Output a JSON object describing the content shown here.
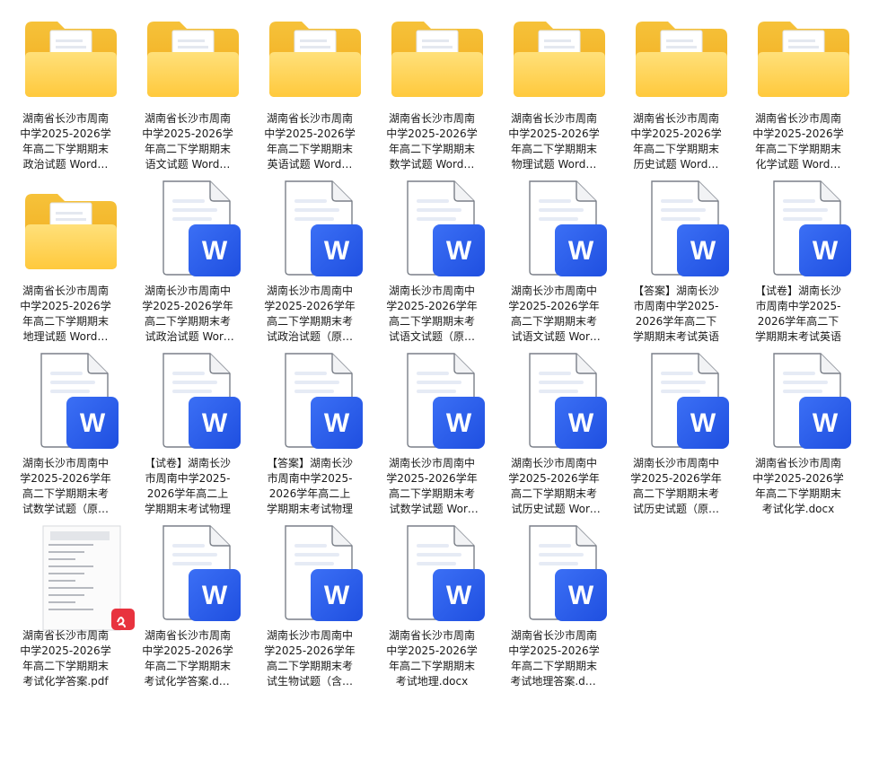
{
  "colors": {
    "folder_back": "#f4b92c",
    "folder_front": "#ffd45c",
    "word_blue": "#2f5ff0",
    "pdf_red": "#e8333f"
  },
  "items": [
    {
      "type": "folder",
      "icon": "folder-icon",
      "label": "湖南省长沙市周南中学2025-2026学年高二下学期期末政治试题 Word版含解析"
    },
    {
      "type": "folder",
      "icon": "folder-icon",
      "label": "湖南省长沙市周南中学2025-2026学年高二下学期期末语文试题 Word版含解析"
    },
    {
      "type": "folder",
      "icon": "folder-icon",
      "label": "湖南省长沙市周南中学2025-2026学年高二下学期期末英语试题 Word版含解析"
    },
    {
      "type": "folder",
      "icon": "folder-icon",
      "label": "湖南省长沙市周南中学2025-2026学年高二下学期期末数学试题 Word版含解析"
    },
    {
      "type": "folder",
      "icon": "folder-icon",
      "label": "湖南省长沙市周南中学2025-2026学年高二下学期期末物理试题 Word版含解析"
    },
    {
      "type": "folder",
      "icon": "folder-icon",
      "label": "湖南省长沙市周南中学2025-2026学年高二下学期期末历史试题 Word版含解析"
    },
    {
      "type": "folder",
      "icon": "folder-icon",
      "label": "湖南省长沙市周南中学2025-2026学年高二下学期期末化学试题 Word版含解析"
    },
    {
      "type": "folder",
      "icon": "folder-icon",
      "label": "湖南省长沙市周南中学2025-2026学年高二下学期期末地理试题 Word版含解析"
    },
    {
      "type": "word",
      "icon": "word-file-icon",
      "label": "湖南长沙市周南中学2025-2026学年高二下学期期末考试政治试题 Word版含解析"
    },
    {
      "type": "word",
      "icon": "word-file-icon",
      "label": "湖南长沙市周南中学2025-2026学年高二下学期期末考试政治试题（原卷版）"
    },
    {
      "type": "word",
      "icon": "word-file-icon",
      "label": "湖南长沙市周南中学2025-2026学年高二下学期期末考试语文试题（原卷版）"
    },
    {
      "type": "word",
      "icon": "word-file-icon",
      "label": "湖南长沙市周南中学2025-2026学年高二下学期期末考试语文试题 Word版含解析"
    },
    {
      "type": "word",
      "icon": "word-file-icon",
      "label": "【答案】湖南长沙市周南中学2025-2026学年高二下学期期末考试英语"
    },
    {
      "type": "word",
      "icon": "word-file-icon",
      "label": "【试卷】湖南长沙市周南中学2025-2026学年高二下学期期末考试英语"
    },
    {
      "type": "word",
      "icon": "word-file-icon",
      "label": "湖南长沙市周南中学2025-2026学年高二下学期期末考试数学试题（原卷版）"
    },
    {
      "type": "word",
      "icon": "word-file-icon",
      "label": "【试卷】湖南长沙市周南中学2025-2026学年高二上学期期末考试物理"
    },
    {
      "type": "word",
      "icon": "word-file-icon",
      "label": "【答案】湖南长沙市周南中学2025-2026学年高二上学期期末考试物理"
    },
    {
      "type": "word",
      "icon": "word-file-icon",
      "label": "湖南长沙市周南中学2025-2026学年高二下学期期末考试数学试题 Word版含解析"
    },
    {
      "type": "word",
      "icon": "word-file-icon",
      "label": "湖南长沙市周南中学2025-2026学年高二下学期期末考试历史试题 Word版含解析"
    },
    {
      "type": "word",
      "icon": "word-file-icon",
      "label": "湖南长沙市周南中学2025-2026学年高二下学期期末考试历史试题（原卷版）"
    },
    {
      "type": "word",
      "icon": "word-file-icon",
      "label": "湖南省长沙市周南中学2025-2026学年高二下学期期末考试化学.docx"
    },
    {
      "type": "pdf",
      "icon": "pdf-thumbnail-icon",
      "label": "湖南省长沙市周南中学2025-2026学年高二下学期期末考试化学答案.pdf"
    },
    {
      "type": "word",
      "icon": "word-file-icon",
      "label": "湖南省长沙市周南中学2025-2026学年高二下学期期末考试化学答案.docx"
    },
    {
      "type": "word",
      "icon": "word-file-icon",
      "label": "湖南长沙市周南中学2025-2026学年高二下学期期末考试生物试题（含答案）"
    },
    {
      "type": "word",
      "icon": "word-file-icon",
      "label": "湖南省长沙市周南中学2025-2026学年高二下学期期末考试地理.docx"
    },
    {
      "type": "word",
      "icon": "word-file-icon",
      "label": "湖南省长沙市周南中学2025-2026学年高二下学期期末考试地理答案.docx"
    }
  ],
  "word_badge_letter": "W"
}
